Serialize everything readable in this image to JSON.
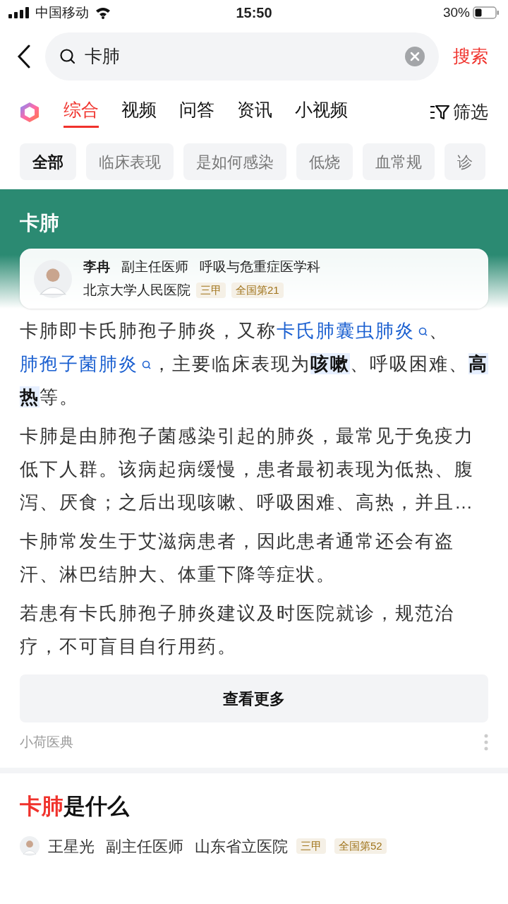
{
  "status_bar": {
    "carrier": "中国移动",
    "time": "15:50",
    "battery": "30%"
  },
  "search": {
    "value": "卡肺",
    "button": "搜索"
  },
  "tabs": [
    {
      "label": "综合",
      "selected": true
    },
    {
      "label": "视频",
      "selected": false
    },
    {
      "label": "问答",
      "selected": false
    },
    {
      "label": "资讯",
      "selected": false
    },
    {
      "label": "小视频",
      "selected": false
    }
  ],
  "filter": "筛选",
  "chips": [
    {
      "label": "全部",
      "selected": true
    },
    {
      "label": "临床表现",
      "selected": false
    },
    {
      "label": "是如何感染",
      "selected": false
    },
    {
      "label": "低烧",
      "selected": false
    },
    {
      "label": "血常规",
      "selected": false
    },
    {
      "label": "诊",
      "selected": false
    }
  ],
  "card": {
    "title": "卡肺",
    "doctor": {
      "name": "李冉",
      "rank": "副主任医师",
      "department": "呼吸与危重症医学科",
      "hospital": "北京大学人民医院",
      "badges": [
        "三甲",
        "全国第21"
      ]
    },
    "paragraphs": [
      [
        {
          "kind": "text",
          "text": "卡肺即卡氏肺孢子肺炎，又称"
        },
        {
          "kind": "link",
          "text": "卡氏肺囊虫肺炎"
        },
        {
          "kind": "text",
          "text": "、"
        },
        {
          "kind": "link",
          "text": "肺孢子菌肺炎"
        },
        {
          "kind": "text",
          "text": "，主要临床表现为"
        },
        {
          "kind": "bold",
          "text": "咳嗽"
        },
        {
          "kind": "text",
          "text": "、呼吸困难、"
        },
        {
          "kind": "bold",
          "text": "高热"
        },
        {
          "kind": "text",
          "text": "等。"
        }
      ],
      [
        {
          "kind": "text",
          "text": "卡肺是由肺孢子菌感染引起的肺炎，最常见于免疫力低下人群。该病起病缓慢，患者最初表现为低热、腹泻、厌食；之后出现咳嗽、呼吸困难、高热，并且…"
        }
      ],
      [
        {
          "kind": "text",
          "text": "卡肺常发生于艾滋病患者，因此患者通常还会有盗汗、淋巴结肿大、体重下降等症状。"
        }
      ],
      [
        {
          "kind": "text",
          "text": "若患有卡氏肺孢子肺炎建议及时医院就诊，规范治疗，不可盲目自行用药。"
        }
      ]
    ],
    "more_button": "查看更多",
    "source": "小荷医典"
  },
  "result": {
    "title": [
      {
        "kind": "hit",
        "text": "卡肺"
      },
      {
        "kind": "text",
        "text": "是什么"
      }
    ],
    "doctor": {
      "name": "王星光",
      "rank": "副主任医师",
      "hospital": "山东省立医院",
      "badges": [
        "三甲",
        "全国第52"
      ]
    }
  }
}
